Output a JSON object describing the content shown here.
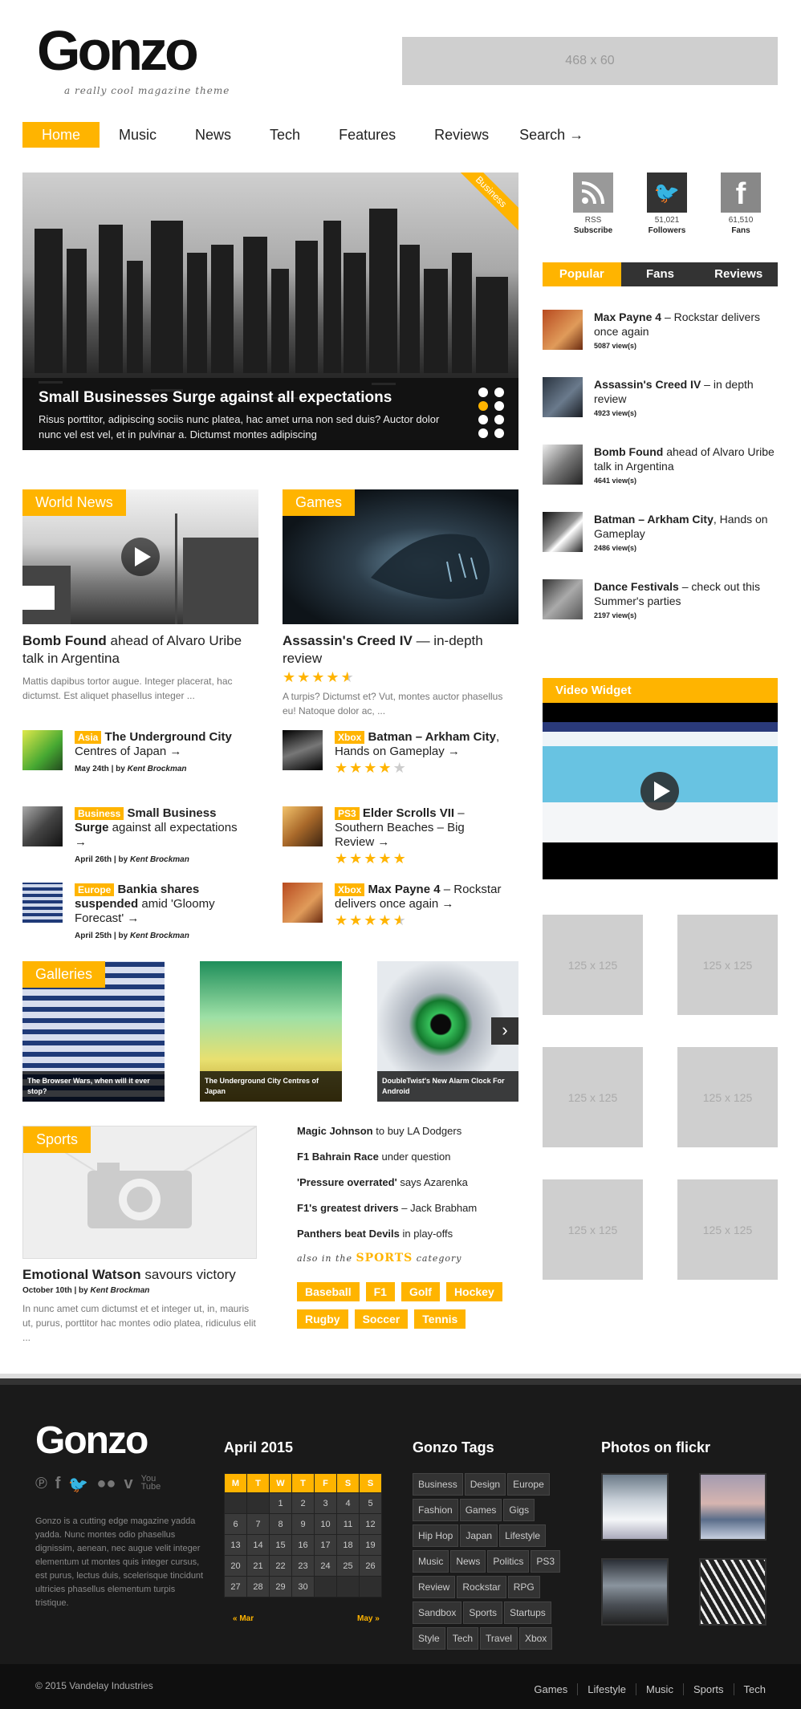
{
  "header": {
    "logo": "Gonzo",
    "tagline": "a really cool magazine theme",
    "ad": "468 x 60"
  },
  "nav": [
    "Home",
    "Music",
    "News",
    "Tech",
    "Features",
    "Reviews",
    "Search →"
  ],
  "hero": {
    "badge": "Business",
    "title": "Small Businesses Surge against all expectations",
    "text": "Risus porttitor, adipiscing sociis nunc platea, hac amet urna non sed duis? Auctor dolor nunc vel est vel, et in pulvinar a. Dictumst montes adipiscing"
  },
  "social": {
    "rss": {
      "count": "RSS",
      "label": "Subscribe"
    },
    "twitter": {
      "count": "51,021",
      "label": "Followers"
    },
    "facebook": {
      "count": "61,510",
      "label": "Fans"
    }
  },
  "tabs": [
    "Popular",
    "Fans",
    "Reviews"
  ],
  "popular": [
    {
      "bold": "Max Payne 4",
      "rest": " – Rockstar delivers once again",
      "views": "5087 view(s)"
    },
    {
      "bold": "Assassin's Creed IV",
      "rest": " – in depth review",
      "views": "4923 view(s)"
    },
    {
      "bold": "Bomb Found",
      "rest": " ahead of Alvaro Uribe talk in Argentina",
      "views": "4641 view(s)"
    },
    {
      "bold": "Batman – Arkham City",
      "rest": ", Hands on Gameplay",
      "views": "2486 view(s)"
    },
    {
      "bold": "Dance Festivals",
      "rest": " – check out this Summer's parties",
      "views": "2197 view(s)"
    }
  ],
  "world_news": {
    "label": "World News",
    "title_bold": "Bomb Found",
    "title_rest": " ahead of Alvaro Uribe talk in Argentina",
    "excerpt": "Mattis dapibus tortor augue. Integer placerat, hac dictumst. Est aliquet phasellus integer ..."
  },
  "games": {
    "label": "Games",
    "title_bold": "Assassin's Creed IV",
    "title_rest": " — in-depth review",
    "rating": 4.5,
    "excerpt": "A turpis? Dictumst et? Vut, montes auctor phasellus eu! Natoque dolor ac, ..."
  },
  "left_list": [
    {
      "tag": "Asia",
      "bold": "The Underground City",
      "rest": " Centres of Japan →",
      "date": "May 24th",
      "author": "Kent Brockman"
    },
    {
      "tag": "Business",
      "bold": "Small Business Surge",
      "rest": " against all expectations →",
      "date": "April 26th",
      "author": "Kent Brockman"
    },
    {
      "tag": "Europe",
      "bold": "Bankia shares suspended",
      "rest": " amid 'Gloomy Forecast' →",
      "date": "April 25th",
      "author": "Kent Brockman"
    }
  ],
  "right_list": [
    {
      "tag": "Xbox",
      "bold": "Batman – Arkham City",
      "rest": ", Hands on Gameplay →",
      "rating": 4
    },
    {
      "tag": "PS3",
      "bold": "Elder Scrolls VII",
      "rest": " – Southern Beaches – Big Review →",
      "rating": 5
    },
    {
      "tag": "Xbox",
      "bold": "Max Payne 4",
      "rest": " – Rockstar delivers once again →",
      "rating": 4.5
    }
  ],
  "byline_sep": "| by",
  "video_widget": {
    "label": "Video Widget"
  },
  "ads125": [
    "125 x 125",
    "125 x 125",
    "125 x 125",
    "125 x 125",
    "125 x 125",
    "125 x 125"
  ],
  "galleries": {
    "label": "Galleries",
    "items": [
      "The Browser Wars, when will it ever stop?",
      "The Underground City Centres of Japan",
      "DoubleTwist's New Alarm Clock For Android"
    ]
  },
  "sports": {
    "label": "Sports",
    "title_bold": "Emotional Watson",
    "title_rest": " savours victory",
    "date": "October 10th",
    "author": "Kent Brockman",
    "excerpt": "In nunc amet cum dictumst et et integer ut, in, mauris ut, purus, porttitor hac montes odio platea, ridiculus elit ..."
  },
  "sports_list": [
    {
      "bold": "Magic Johnson",
      "rest": " to buy LA Dodgers"
    },
    {
      "bold": "F1 Bahrain Race",
      "rest": " under question"
    },
    {
      "bold": "'Pressure overrated'",
      "rest": " says Azarenka"
    },
    {
      "bold": "F1's greatest drivers",
      "rest": " – Jack Brabham"
    },
    {
      "bold": "Panthers beat Devils",
      "rest": " in play-offs"
    }
  ],
  "also": {
    "pre": "also in the",
    "cat": "SPORTS",
    "post": "category"
  },
  "sport_tags": [
    "Baseball",
    "F1",
    "Golf",
    "Hockey",
    "Rugby",
    "Soccer",
    "Tennis"
  ],
  "footer": {
    "logo": "Gonzo",
    "about": "Gonzo is a cutting edge magazine yadda yadda. Nunc montes odio phasellus dignissim, aenean, nec augue velit integer elementum ut montes quis integer cursus, est purus, lectus duis, scelerisque tincidunt ultricies phasellus elementum turpis tristique.",
    "calendar_title": "April 2015",
    "days": [
      "M",
      "T",
      "W",
      "T",
      "F",
      "S",
      "S"
    ],
    "weeks": [
      [
        "",
        "",
        "1",
        "2",
        "3",
        "4",
        "5"
      ],
      [
        "6",
        "7",
        "8",
        "9",
        "10",
        "11",
        "12"
      ],
      [
        "13",
        "14",
        "15",
        "16",
        "17",
        "18",
        "19"
      ],
      [
        "20",
        "21",
        "22",
        "23",
        "24",
        "25",
        "26"
      ],
      [
        "27",
        "28",
        "29",
        "30",
        "",
        "",
        ""
      ]
    ],
    "prev": "« Mar",
    "next": "May »",
    "tags_title": "Gonzo Tags",
    "tags": [
      "Business",
      "Design",
      "Europe",
      "Fashion",
      "Games",
      "Gigs",
      "Hip Hop",
      "Japan",
      "Lifestyle",
      "Music",
      "News",
      "Politics",
      "PS3",
      "Review",
      "Rockstar",
      "RPG",
      "Sandbox",
      "Sports",
      "Startups",
      "Style",
      "Tech",
      "Travel",
      "Xbox"
    ],
    "flickr_title": "Photos on flickr",
    "copyright": "© 2015 Vandelay Industries",
    "links": [
      "Games",
      "Lifestyle",
      "Music",
      "Sports",
      "Tech"
    ]
  },
  "colors": {
    "accent": "#ffb400",
    "footer_bg": "#1a1a1a"
  }
}
